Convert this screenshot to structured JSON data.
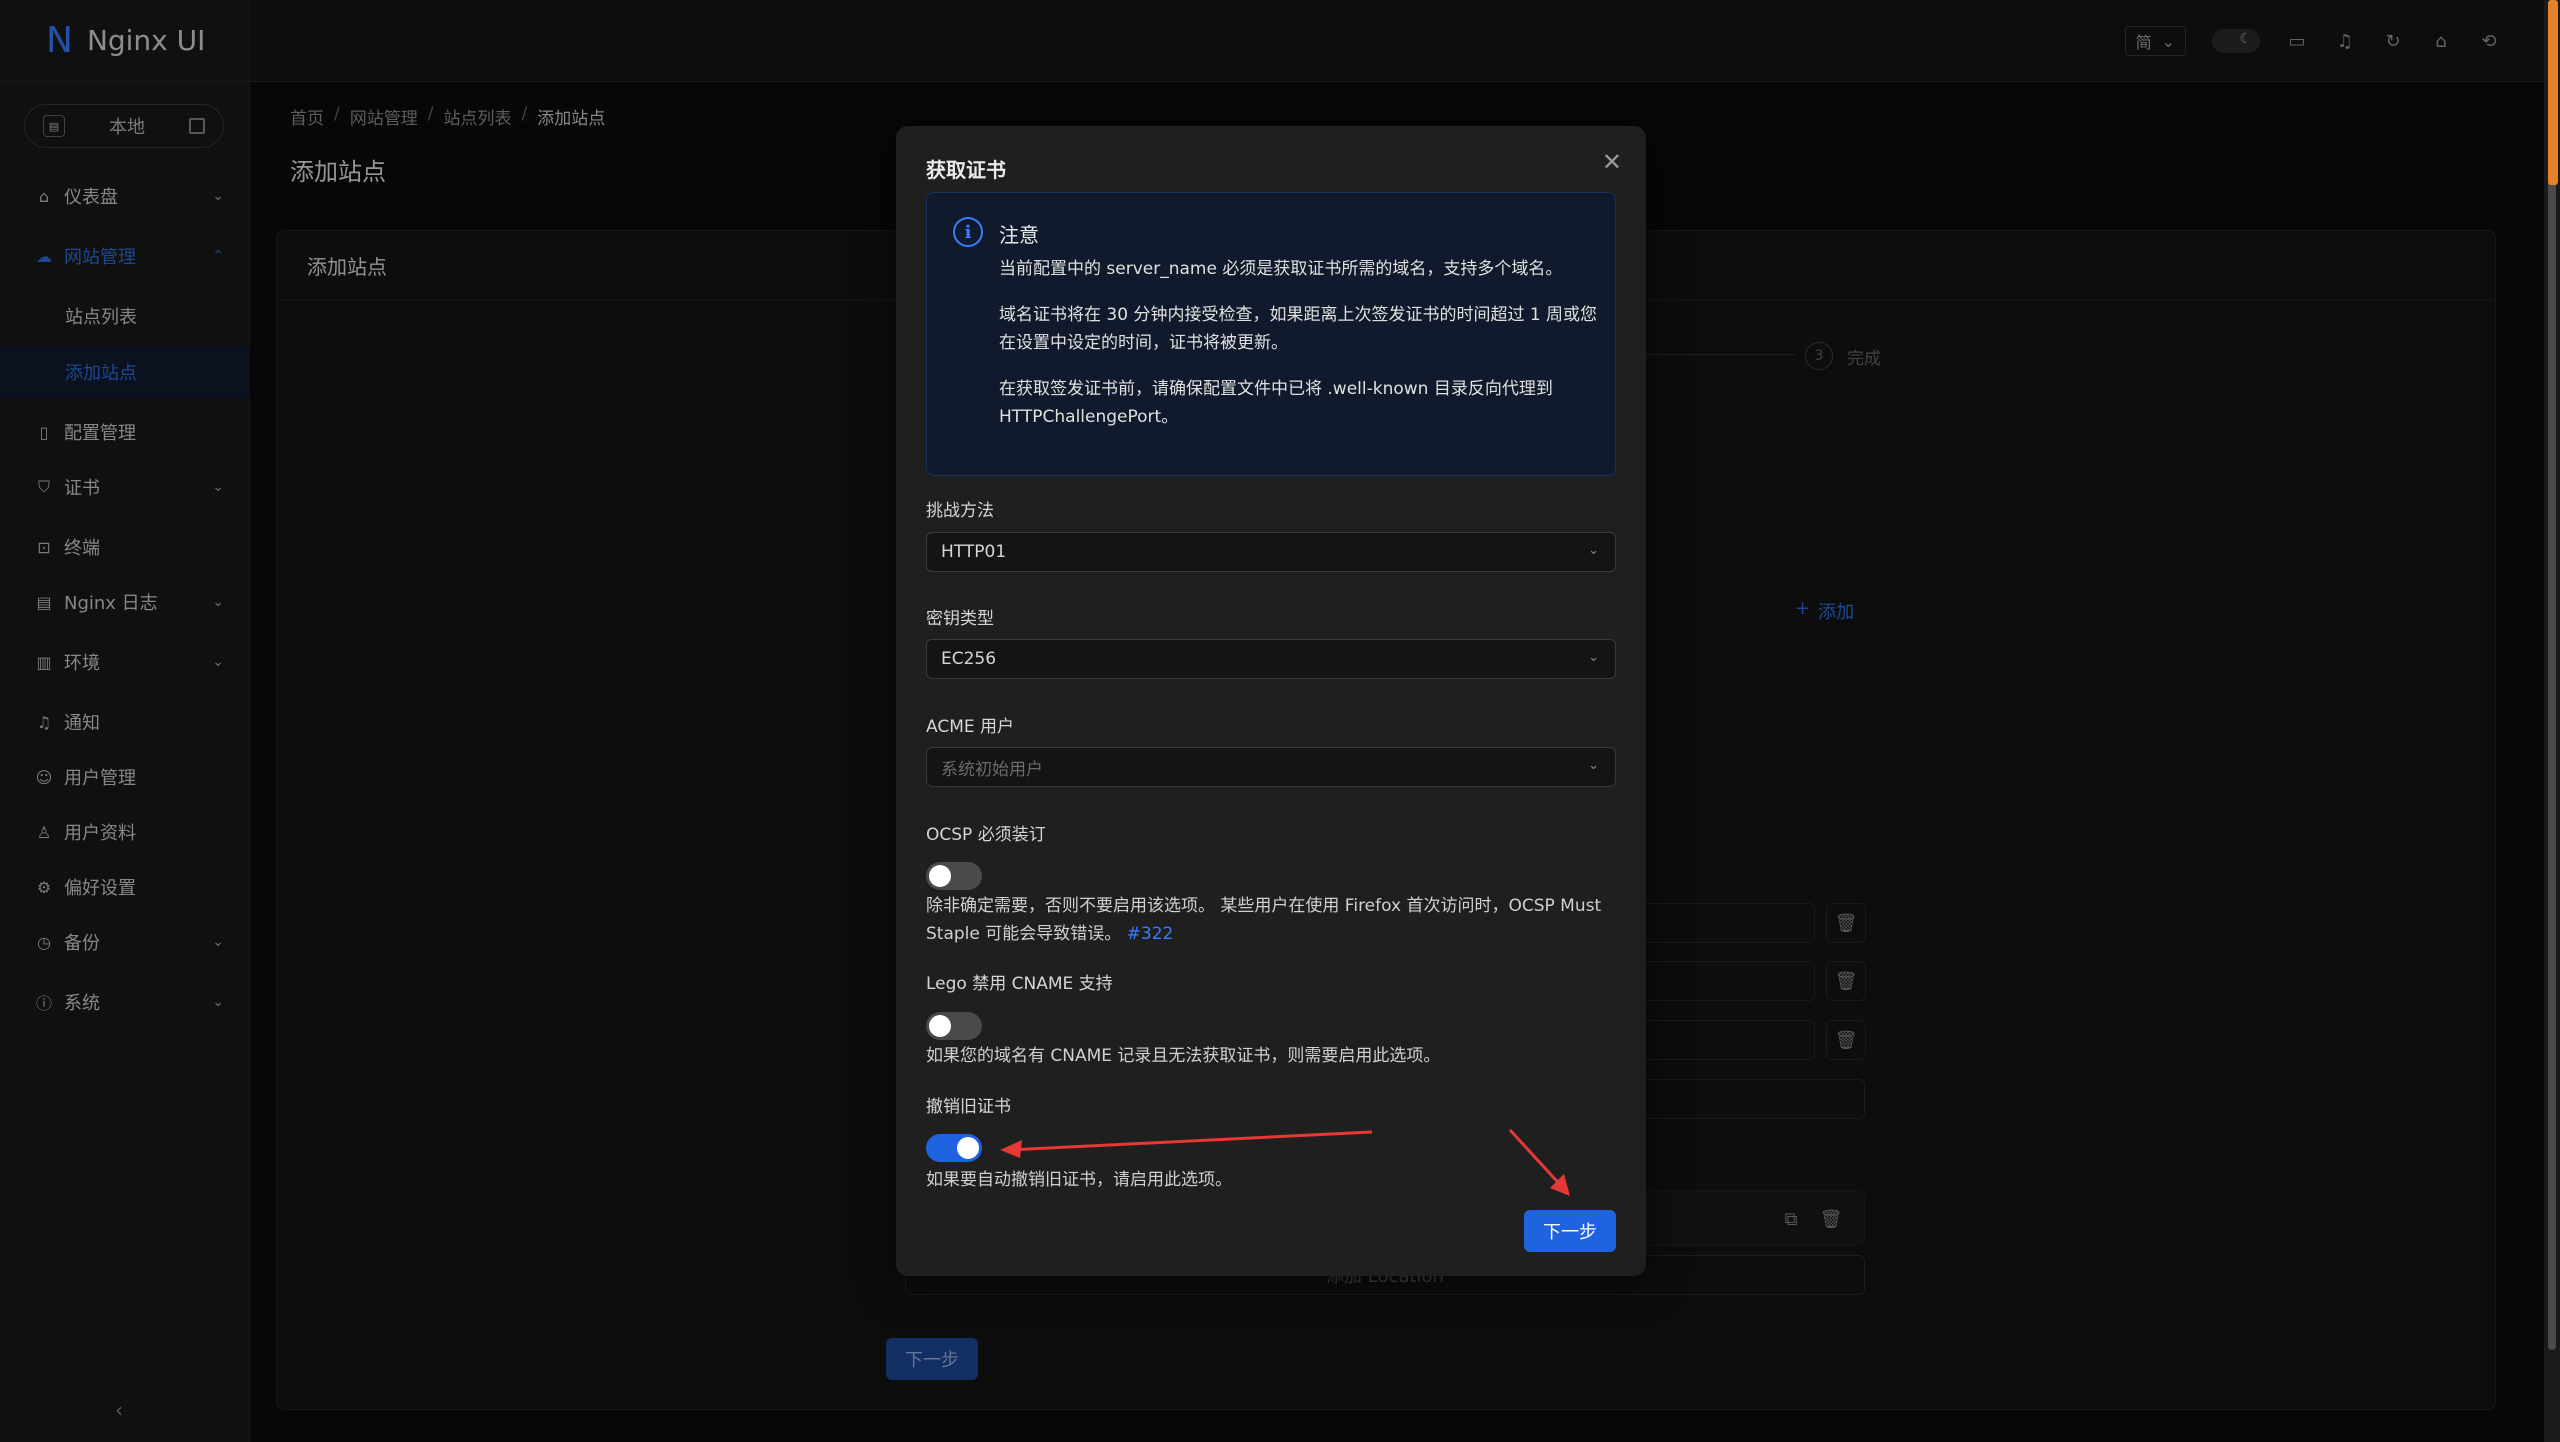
{
  "app": {
    "logo_letter": "N",
    "name": "Nginx UI"
  },
  "env_switch": {
    "label": "本地"
  },
  "sidebar": {
    "items": [
      {
        "label": "仪表盘",
        "icon": "home-icon",
        "has_children": true
      },
      {
        "label": "网站管理",
        "icon": "cloud-icon",
        "has_children": true,
        "expanded": true
      },
      {
        "label": "站点列表",
        "sub": true
      },
      {
        "label": "添加站点",
        "sub": true,
        "selected": true
      },
      {
        "label": "配置管理",
        "icon": "file-icon"
      },
      {
        "label": "证书",
        "icon": "shield-icon",
        "has_children": true
      },
      {
        "label": "终端",
        "icon": "terminal-icon"
      },
      {
        "label": "Nginx 日志",
        "icon": "log-icon",
        "has_children": true
      },
      {
        "label": "环境",
        "icon": "database-icon",
        "has_children": true
      },
      {
        "label": "通知",
        "icon": "bell-icon"
      },
      {
        "label": "用户管理",
        "icon": "users-icon"
      },
      {
        "label": "用户资料",
        "icon": "user-icon"
      },
      {
        "label": "偏好设置",
        "icon": "gear-icon"
      },
      {
        "label": "备份",
        "icon": "clock-icon",
        "has_children": true
      },
      {
        "label": "系统",
        "icon": "info-icon",
        "has_children": true
      }
    ]
  },
  "topbar": {
    "lang": "简"
  },
  "breadcrumb": [
    "首页",
    "网站管理",
    "站点列表",
    "添加站点"
  ],
  "page_title": "添加站点",
  "card_title": "添加站点",
  "steps": {
    "done_number": "3",
    "done_label": "完成"
  },
  "background": {
    "add_label": "添加",
    "add_location": "添加 Location",
    "next": "下一步"
  },
  "modal": {
    "title": "获取证书",
    "notice": {
      "title": "注意",
      "p1": "当前配置中的 server_name 必须是获取证书所需的域名，支持多个域名。",
      "p2": "域名证书将在 30 分钟内接受检查，如果距离上次签发证书的时间超过 1 周或您在设置中设定的时间，证书将被更新。",
      "p3": "在获取签发证书前，请确保配置文件中已将 .well-known 目录反向代理到 HTTPChallengePort。"
    },
    "challenge": {
      "label": "挑战方法",
      "value": "HTTP01"
    },
    "key_type": {
      "label": "密钥类型",
      "value": "EC256"
    },
    "acme_user": {
      "label": "ACME 用户",
      "placeholder": "系统初始用户"
    },
    "ocsp": {
      "label": "OCSP 必须装订",
      "enabled": false,
      "help": "除非确定需要，否则不要启用该选项。 某些用户在使用 Firefox 首次访问时，OCSP Must Staple 可能会导致错误。",
      "link": "#322"
    },
    "lego_cname": {
      "label": "Lego 禁用 CNAME 支持",
      "enabled": false,
      "help": "如果您的域名有 CNAME 记录且无法获取证书，则需要启用此选项。"
    },
    "revoke_old": {
      "label": "撤销旧证书",
      "enabled": true,
      "help": "如果要自动撤销旧证书，请启用此选项。"
    },
    "next": "下一步"
  },
  "colors": {
    "accent": "#1f63e0",
    "annotation": "#e53935"
  }
}
